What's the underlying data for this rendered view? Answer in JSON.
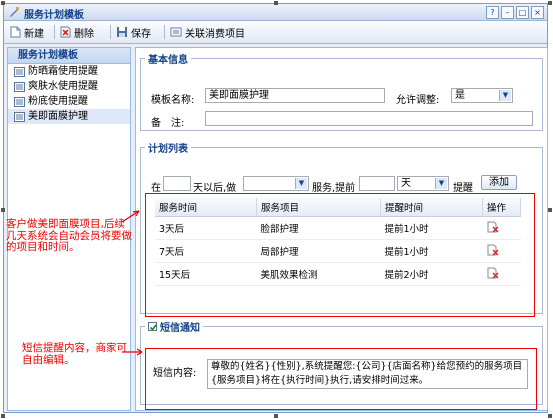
{
  "window": {
    "title": "服务计划模板",
    "controls": [
      "?",
      "–",
      "□",
      "×"
    ]
  },
  "toolbar": {
    "new_label": "新建",
    "delete_label": "删除",
    "save_label": "保存",
    "link_label": "关联消费项目"
  },
  "sidebar": {
    "title": "服务计划模板",
    "items": [
      {
        "label": "防晒霜使用提醒"
      },
      {
        "label": "爽肤水使用提醒"
      },
      {
        "label": "粉底使用提醒"
      },
      {
        "label": "美即面膜护理"
      }
    ]
  },
  "basic": {
    "legend": "基本信息",
    "template_name_label": "模板名称:",
    "template_name_value": "美即面膜护理",
    "adjust_label": "允许调整:",
    "adjust_value": "是",
    "remark_label": "备　注:",
    "remark_value": ""
  },
  "plan": {
    "legend": "计划列表",
    "at_label": "在",
    "days_value": "",
    "after_label": "天以后,做",
    "do_value": "",
    "service_advance_label": "服务,提前",
    "advance_value": "",
    "unit_value": "天",
    "remind_label": "提醒",
    "add_label": "添加",
    "columns": [
      "服务时间",
      "服务项目",
      "提醒时间",
      "操作"
    ],
    "rows": [
      {
        "time": "3天后",
        "item": "脸部护理",
        "remind": "提前1小时"
      },
      {
        "time": "7天后",
        "item": "局部护理",
        "remind": "提前1小时"
      },
      {
        "time": "15天后",
        "item": "美肌效果检测",
        "remind": "提前2小时"
      }
    ]
  },
  "sms": {
    "legend": "短信通知",
    "checked": true,
    "content_label": "短信内容:",
    "content_value": "尊敬的{姓名}{性别},系统提醒您:{公司}{店面名称}给您预约的服务项目{服务项目}将在{执行时间}执行,请安排时间过来。"
  },
  "annotations": {
    "plan_note": "客户做美即面膜项目,后续几天系统会自动会员将要做的项目和时间。",
    "sms_note": "短信提醒内容，商家可自由编辑。"
  },
  "colors": {
    "accent": "#15428b",
    "annotation": "#ee0000"
  }
}
